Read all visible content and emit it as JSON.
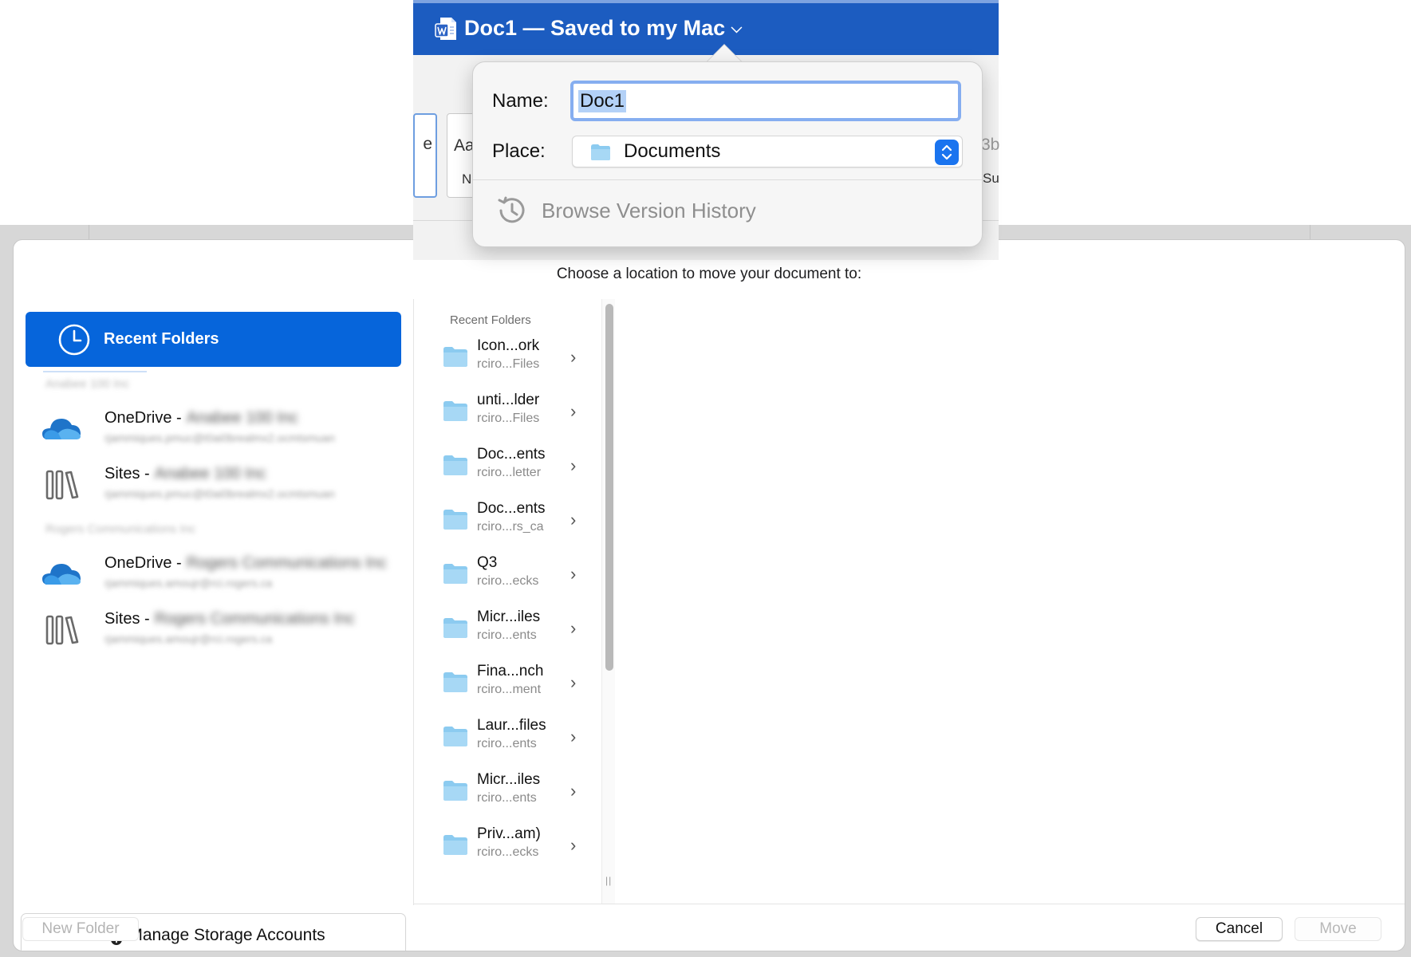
{
  "word_window": {
    "title": "Doc1 — Saved to my Mac",
    "ribbon_style_left": "e",
    "ribbon_style_aa": "Aa",
    "ribbon_style_aa_sub": "N",
    "ribbon_style_right": "3b",
    "ribbon_style_right_sub": "Su"
  },
  "save_popover": {
    "name_label": "Name:",
    "name_value": "Doc1",
    "place_label": "Place:",
    "place_value": "Documents",
    "version_history_label": "Browse Version History"
  },
  "dialog": {
    "prompt": "Choose a location to move your document to:",
    "sidebar": {
      "recent_folders_label": "Recent Folders",
      "groups": [
        {
          "label": "Anabee 100 Inc",
          "accounts": [
            {
              "type": "OneDrive",
              "title_prefix": "OneDrive -",
              "title_blurred": "Anabee 100 Inc",
              "subtitle": "rjammiques.pmuc@t0ai0brealmx2.ocmtsmuan"
            },
            {
              "type": "Sites",
              "title_prefix": "Sites -",
              "title_blurred": "Anabee 100 Inc",
              "subtitle": "rjammiques.pmuc@t0ai0brealmx2.ocmtsmuan"
            }
          ]
        },
        {
          "label": "Rogers Communications Inc",
          "accounts": [
            {
              "type": "OneDrive",
              "title_prefix": "OneDrive -",
              "title_blurred": "Rogers Communications Inc",
              "subtitle": "rjammiques.amoujr@rci.rogers.ca"
            },
            {
              "type": "Sites",
              "title_prefix": "Sites -",
              "title_blurred": "Rogers Communications Inc",
              "subtitle": "rjammiques.amoujr@rci.rogers.ca"
            }
          ]
        }
      ],
      "manage_label": "Manage Storage Accounts"
    },
    "folder_list": {
      "header": "Recent Folders",
      "items": [
        {
          "name": "Icon...ork",
          "path": "rciro...Files"
        },
        {
          "name": "unti...lder",
          "path": "rciro...Files"
        },
        {
          "name": "Doc...ents",
          "path": "rciro...letter"
        },
        {
          "name": "Doc...ents",
          "path": "rciro...rs_ca"
        },
        {
          "name": "Q3",
          "path": "rciro...ecks"
        },
        {
          "name": "Micr...iles",
          "path": "rciro...ents"
        },
        {
          "name": "Fina...nch",
          "path": "rciro...ment"
        },
        {
          "name": "Laur...files",
          "path": "rciro...ents"
        },
        {
          "name": "Micr...iles",
          "path": "rciro...ents"
        },
        {
          "name": "Priv...am)",
          "path": "rciro...ecks"
        }
      ]
    },
    "buttons": {
      "new_folder": "New Folder",
      "cancel": "Cancel",
      "move": "Move"
    }
  },
  "colors": {
    "accent": "#0665db",
    "word_blue": "#1c5cc0",
    "folder_icon": "#8ccbf0"
  },
  "icons": {
    "recent": "clock-icon",
    "onedrive": "onedrive-cloud-icon",
    "sites": "sites-library-icon",
    "manage": "cloud-plus-icon",
    "folder": "folder-icon",
    "version_history": "history-icon"
  }
}
